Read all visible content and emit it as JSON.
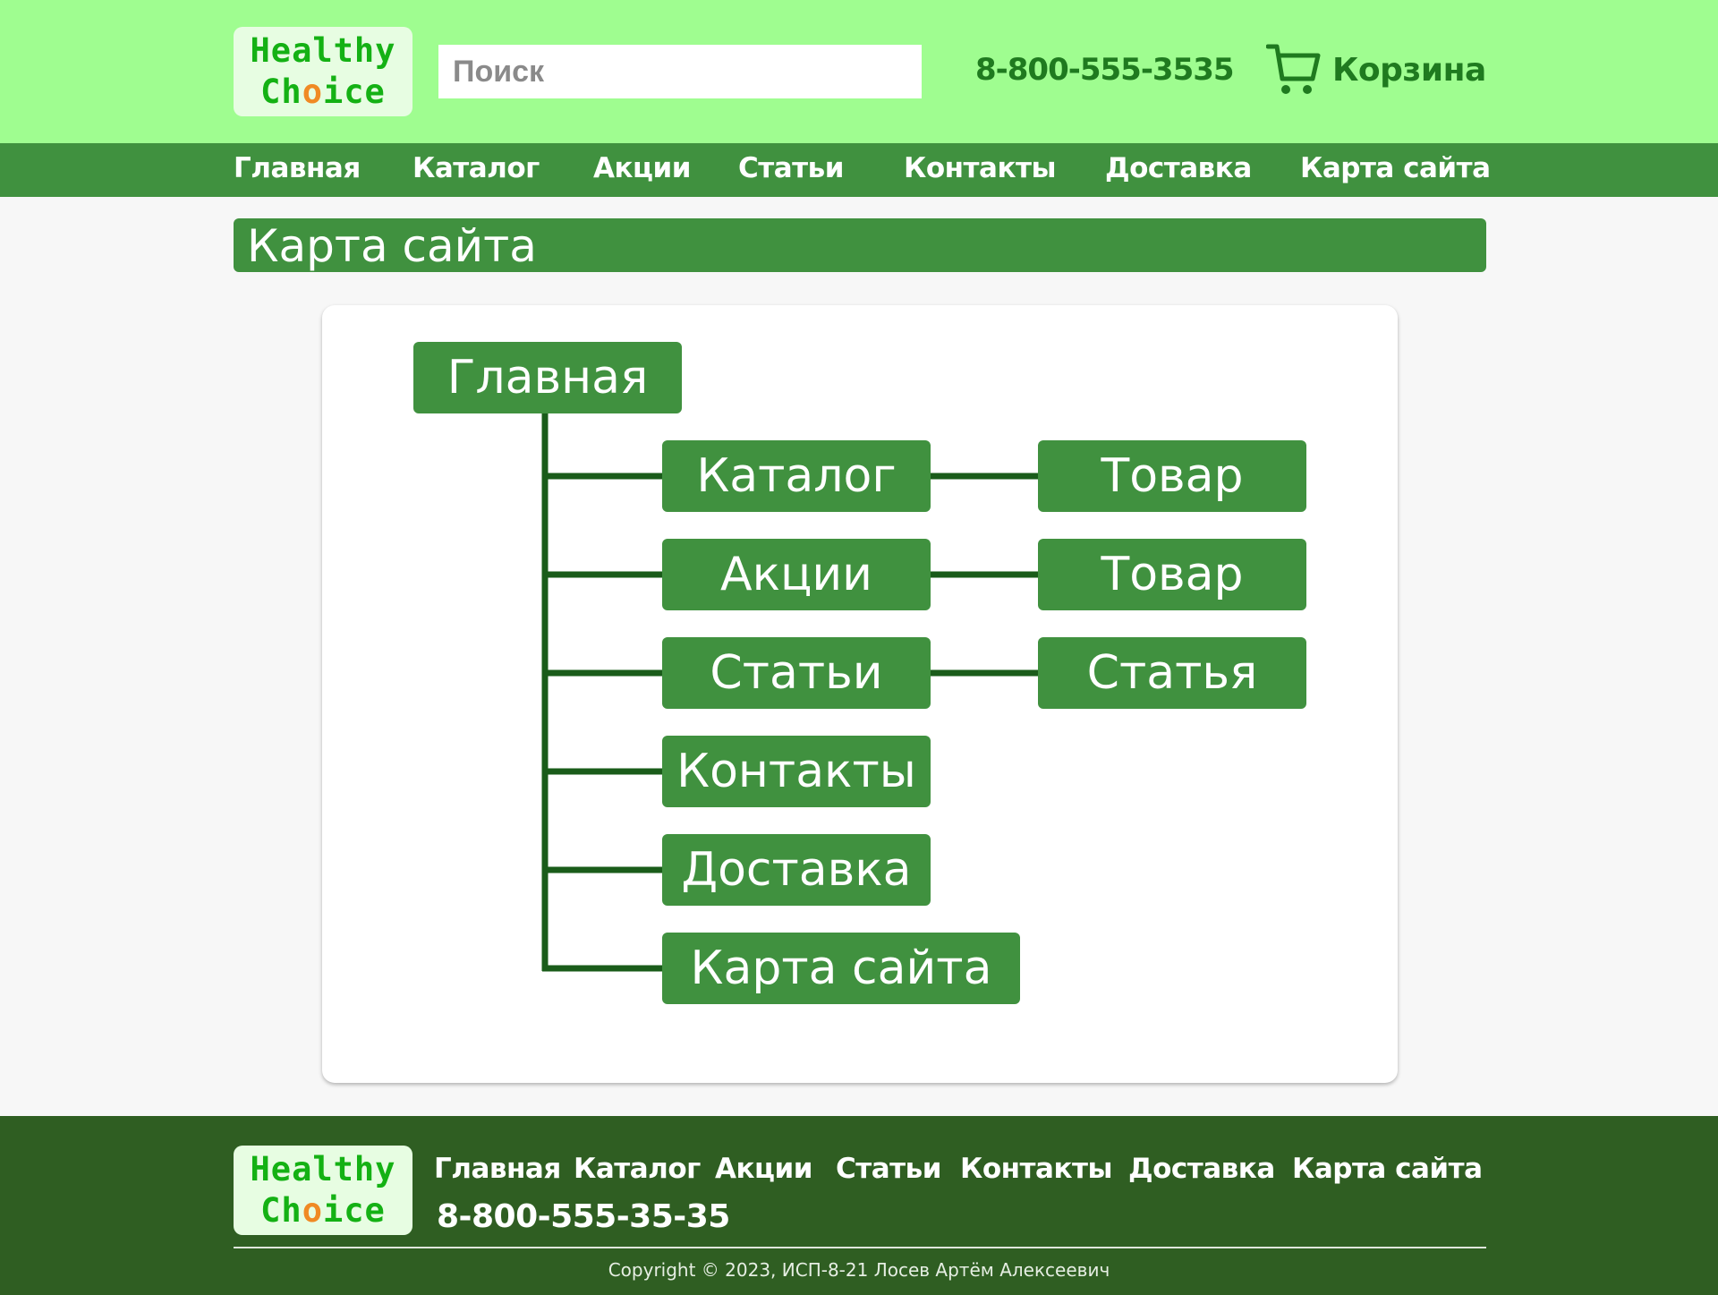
{
  "brand": {
    "line1": "Healthy",
    "line2_before": "Ch",
    "line2_o": "o",
    "line2_after": "ice"
  },
  "header": {
    "search_placeholder": "Поиск",
    "phone": "8-800-555-3535",
    "cart_label": "Корзина",
    "cart_icon": "cart-icon"
  },
  "nav": {
    "items": [
      {
        "label": "Главная"
      },
      {
        "label": "Каталог"
      },
      {
        "label": "Акции"
      },
      {
        "label": "Статьи"
      },
      {
        "label": "Контакты"
      },
      {
        "label": "Доставка"
      },
      {
        "label": "Карта сайта"
      }
    ]
  },
  "page": {
    "title": "Карта сайта"
  },
  "sitemap": {
    "root": "Главная",
    "children": [
      {
        "label": "Каталог",
        "child": "Товар"
      },
      {
        "label": "Акции",
        "child": "Товар"
      },
      {
        "label": "Статьи",
        "child": "Статья"
      },
      {
        "label": "Контакты"
      },
      {
        "label": "Доставка"
      },
      {
        "label": "Карта сайта"
      }
    ]
  },
  "footer": {
    "nav": [
      {
        "label": "Главная"
      },
      {
        "label": "Каталог"
      },
      {
        "label": "Акции"
      },
      {
        "label": "Статьи"
      },
      {
        "label": "Контакты"
      },
      {
        "label": "Доставка"
      },
      {
        "label": "Карта сайта"
      }
    ],
    "phone": "8-800-555-35-35",
    "copyright": "Copyright © 2023, ИСП-8-21 Лосев Артём Алексеевич"
  },
  "colors": {
    "header_bg": "#9ffd90",
    "nav_bg": "#40913f",
    "accent_text": "#1f7a1f",
    "tree_line": "#1a5c1a",
    "footer_bg": "#2f5e22",
    "logo_green": "#14b114",
    "logo_orange": "#f08a24"
  }
}
